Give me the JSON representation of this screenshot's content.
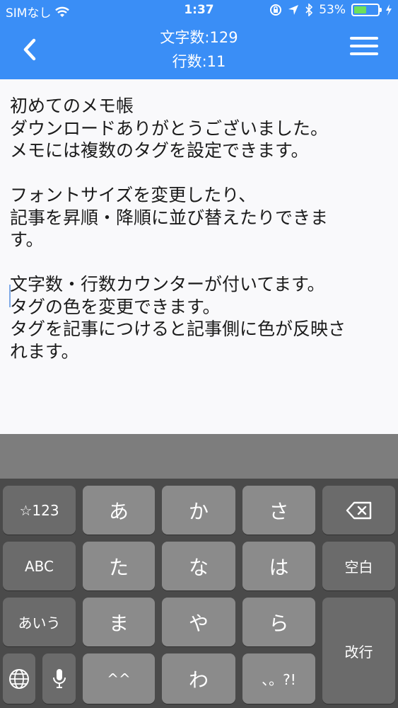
{
  "status_bar": {
    "carrier": "SIMなし",
    "time": "1:37",
    "battery_percent": "53%",
    "battery_level": 0.53
  },
  "navbar": {
    "char_count": "文字数:129",
    "line_count": "行数:11"
  },
  "editor": {
    "text": "初めてのメモ帳\nダウンロードありがとうございました。\nメモには複数のタグを設定できます。\n\nフォントサイズを変更したり、\n記事を昇順・降順に並び替えたりできま\nす。\n\n文字数・行数カウンターが付いてます。\nタグの色を変更できます。\nタグを記事につけると記事側に色が反映さ\nれます。"
  },
  "keyboard": {
    "row1": [
      "☆123",
      "あ",
      "か",
      "さ"
    ],
    "row2": [
      "ABC",
      "た",
      "な",
      "は",
      "空白"
    ],
    "row3": [
      "あいう",
      "ま",
      "や",
      "ら"
    ],
    "row4": [
      "^^",
      "わ",
      "、。?!"
    ],
    "return_label": "改行"
  },
  "colors": {
    "header": "#3a8ef6",
    "keyboard_bg": "#4a4a4a",
    "battery_fill": "#6de05a"
  }
}
